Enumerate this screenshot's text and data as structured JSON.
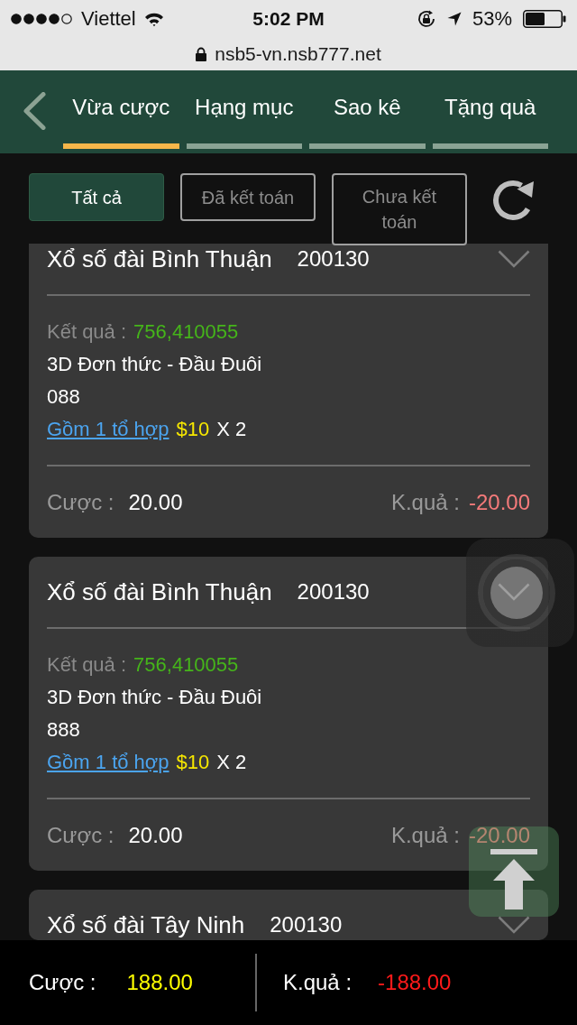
{
  "status_bar": {
    "carrier": "Viettel",
    "time": "5:02 PM",
    "battery": "53%"
  },
  "address_bar": {
    "url": "nsb5-vn.nsb777.net"
  },
  "tabs": [
    {
      "label": "Vừa cược",
      "selected": true
    },
    {
      "label": "Hạng mục",
      "selected": false
    },
    {
      "label": "Sao kê",
      "selected": false
    },
    {
      "label": "Tặng quà",
      "selected": false
    }
  ],
  "filters": [
    {
      "label": "Tất cả",
      "selected": true
    },
    {
      "label": "Đã kết toán",
      "selected": false
    },
    {
      "label": "Chưa kết toán",
      "selected": false
    }
  ],
  "bets": [
    {
      "title": "Xổ số đài Bình Thuận",
      "draw": "200130",
      "result_label": "Kết quả :",
      "result": "756,410055",
      "bet_type": "3D Đơn thức - Đầu Đuôi",
      "numbers": "088",
      "combo_link": "Gồm 1 tổ hợp",
      "stake": "$10",
      "multiplier": "X 2",
      "bet_label": "Cược :",
      "bet_amount": "20.00",
      "outcome_label": "K.quả :",
      "outcome": "-20.00"
    },
    {
      "title": "Xổ số đài Bình Thuận",
      "draw": "200130",
      "result_label": "Kết quả :",
      "result": "756,410055",
      "bet_type": "3D Đơn thức - Đầu Đuôi",
      "numbers": "888",
      "combo_link": "Gồm 1 tổ hợp",
      "stake": "$10",
      "multiplier": "X 2",
      "bet_label": "Cược :",
      "bet_amount": "20.00",
      "outcome_label": "K.quả :",
      "outcome": "-20.00"
    },
    {
      "title": "Xổ số đài Tây Ninh",
      "draw": "200130"
    }
  ],
  "summary": {
    "bet_label": "Cược :",
    "bet_amount": "188.00",
    "outcome_label": "K.quả :",
    "outcome": "-188.00"
  }
}
